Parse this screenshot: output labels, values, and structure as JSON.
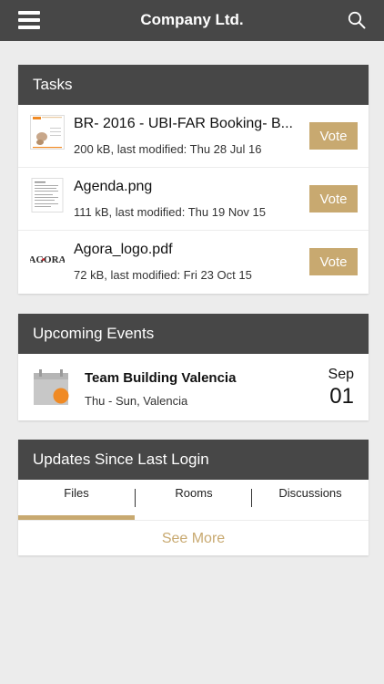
{
  "header": {
    "title": "Company Ltd.",
    "menu_icon": "hamburger-menu-icon",
    "search_icon": "search-icon"
  },
  "tasks": {
    "title": "Tasks",
    "items": [
      {
        "name": "BR- 2016 - UBI-FAR Booking- B...",
        "meta": "200 kB, last modified: Thu 28 Jul 16",
        "vote_label": "Vote"
      },
      {
        "name": "Agenda.png",
        "meta": "111 kB, last modified: Thu 19 Nov 15",
        "vote_label": "Vote"
      },
      {
        "name": "Agora_logo.pdf",
        "meta": "72 kB, last modified: Fri 23 Oct 15",
        "vote_label": "Vote",
        "logo_text": "AGORA"
      }
    ]
  },
  "events": {
    "title": "Upcoming Events",
    "items": [
      {
        "name": "Team Building Valencia",
        "subtitle": "Thu - Sun, Valencia",
        "month": "Sep",
        "day": "01"
      }
    ]
  },
  "updates": {
    "title": "Updates Since Last Login",
    "tabs": [
      "Files",
      "Rooms",
      "Discussions"
    ],
    "active_tab": "Files",
    "see_more": "See More"
  },
  "colors": {
    "header_bg": "#474747",
    "accent": "#c8a970",
    "background": "#ececec",
    "event_dot": "#f08a24"
  }
}
